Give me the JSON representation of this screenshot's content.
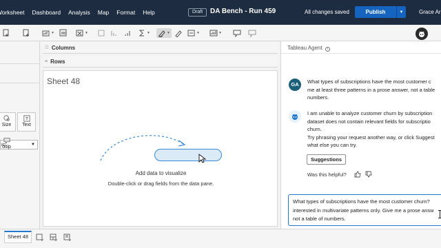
{
  "menubar": {
    "items": [
      "Worksheet",
      "Dashboard",
      "Analysis",
      "Map",
      "Format",
      "Help"
    ],
    "draft_badge": "Draft",
    "workbook_title": "DA Bench - Run 459",
    "save_status": "All changes saved",
    "publish_label": "Publish",
    "user_name": "Grace Ar"
  },
  "toolbar": {
    "icons": [
      "duplicate-sheet-icon",
      "add-datasource-icon",
      "swap-icon",
      "sort-icon",
      "group-icon",
      "totals-icon",
      "highlight-icon",
      "annotate-icon",
      "fit-icon",
      "tooltip-icon",
      "presentation-icon",
      "agent-icon"
    ]
  },
  "marks": {
    "mark_type": "ic",
    "cards": [
      {
        "label": "Size"
      },
      {
        "label": "Text"
      },
      {
        "label": "oltip"
      }
    ]
  },
  "shelves": {
    "columns": "Columns",
    "rows": "Rows"
  },
  "canvas": {
    "sheet_title": "Sheet 48",
    "add_data_title": "Add data to visualize",
    "add_data_subtitle": "Double-click or drag fields from the data pane."
  },
  "agent": {
    "title": "Tableau Agent",
    "user_initials": "GA",
    "user_message": [
      "What types of subscriptions have the most customer c",
      "me at least three patterns in a prose answer, not a table",
      "numbers."
    ],
    "bot_message": [
      "I am unable to analyze customer churn by subscription",
      "dataset does not contain relevant fields for subscriptio",
      "churn.",
      "Try phrasing your request another way, or click Suggest",
      "what else you can try."
    ],
    "suggestions_label": "Suggestions",
    "helpful_label": "Was this helpful?",
    "input_lines": [
      "What types of subscriptions have the most customer churn?",
      "interested in multivariate patterns only. Give me a prose answ",
      "not a table of numbers."
    ]
  },
  "tabs": {
    "active_sheet": "Sheet 48"
  },
  "colors": {
    "menubar_bg": "#1d2c41",
    "publish": "#1565c0",
    "accent": "#1f77d0"
  }
}
